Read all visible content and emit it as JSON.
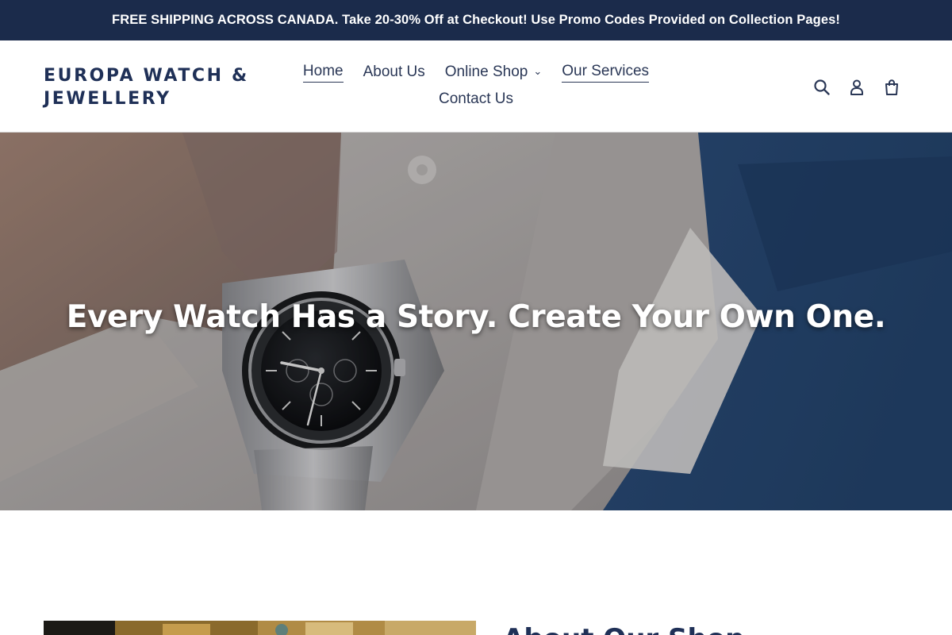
{
  "announcement": {
    "text": "FREE SHIPPING ACROSS CANADA. Take 20-30% Off at Checkout! Use Promo Codes Provided on Collection Pages!"
  },
  "header": {
    "logo": "EUROPA WATCH & JEWELLERY",
    "nav": [
      {
        "label": "Home",
        "underlined": true
      },
      {
        "label": "About Us",
        "underlined": false
      },
      {
        "label": "Online Shop",
        "dropdown": true,
        "underlined": false
      },
      {
        "label": "Our Services",
        "underlined": true
      },
      {
        "label": "Contact Us",
        "underlined": false
      }
    ],
    "icons": [
      "search-icon",
      "account-icon",
      "cart-icon"
    ]
  },
  "hero": {
    "heading": "Every Watch Has a Story. Create Your Own One."
  },
  "feature": {
    "heading": "About Our Shop"
  },
  "colors": {
    "announcement_bg": "#1b2b4b",
    "brand": "#1f3057",
    "nav_text": "#2a3756",
    "suit_blue": "#2f4f7a"
  }
}
